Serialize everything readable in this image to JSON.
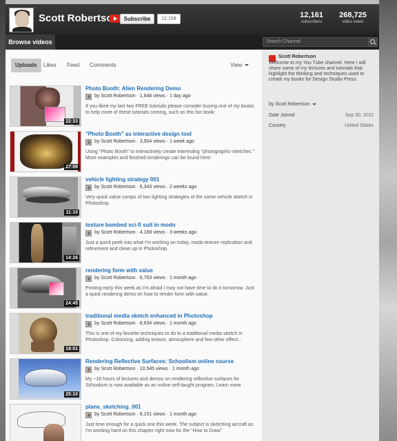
{
  "header": {
    "channel_name": "Scott Robertson",
    "subscribe_label": "Subscribe",
    "subscriber_bubble": "12,159",
    "stats": [
      {
        "number": "12,161",
        "label": "subscribers"
      },
      {
        "number": "268,725",
        "label": "video views"
      }
    ]
  },
  "nav": {
    "browse_label": "Browse videos",
    "search_placeholder": "Search Channel"
  },
  "tabs": {
    "uploads": "Uploads",
    "likes": "Likes",
    "feed": "Feed",
    "comments": "Comments",
    "view": "View"
  },
  "videos": [
    {
      "title": "Photo Booth: Alien Rendering Demo",
      "meta": "by Scott Robertson · 1,848 views · 1 day ago",
      "description": "If you liked my last two FREE tutorials please consider buying one of my books to help more of these tutorials coming, such as this fun book:",
      "duration": "22:33"
    },
    {
      "title": "\"Photo Booth\" as interactive design tool",
      "meta": "by Scott Robertson · 3,504 views · 1 week ago",
      "description": "Using \"Photo Booth\" to interactively create interesting \"photographic-sketches.\" More examples and finished renderings can be found here:",
      "duration": "27:08"
    },
    {
      "title": "vehicle lighting strategy 001",
      "meta": "by Scott Robertson · 6,343 views · 2 weeks ago",
      "description": "Very quick value comps of two lighting strategies of the same vehicle sketch in Photoshop.",
      "duration": "11:10"
    },
    {
      "title": "texture bombed sci-fi suit in modo",
      "meta": "by Scott Robertson · 4,168 views · 3 weeks ago",
      "description": "Just a quick peek into what I'm working on today, modo texture replication and refinement and clean up in Photoshop.",
      "duration": "14:26"
    },
    {
      "title": "rendering form with value",
      "meta": "by Scott Robertson · 6,703 views · 1 month ago",
      "description": "Posting early this week as I'm afraid I may not have time to do it tomorrow. Just a quick rendering demo on how to render form with value.",
      "duration": "24:45"
    },
    {
      "title": "traditional media sketch enhanced in Photoshop",
      "meta": "by Scott Robertson · 8,634 views · 1 month ago",
      "description": "This is one of my favorite techniques to do to a traditional media sketch in Photoshop. Colorizing, adding texture, atmosphere and few other effect...",
      "duration": "18:01"
    },
    {
      "title": "Rendering Reflective Surfaces: Schoolism online course",
      "meta": "by Scott Robertson · 10,545 views · 1 month ago",
      "description": "My ~18 hours of lectures and demos on rendering reflective surfaces for Schoolism is now available as an online self-taught program. Learn more",
      "duration": "25:10"
    },
    {
      "title": "plane_sketching_001",
      "meta": "by Scott Robertson · 6,151 views · 1 month ago",
      "description": "Just time enough for a quick one this week. The subject is sketching aircraft as I'm working hard on this chapter right now for the \"How to Draw\"",
      "duration": ""
    }
  ],
  "sidebar": {
    "name": "Scott Robertson",
    "about": "Welcome to my You Tube channel. Here I will share some of my lectures and tutorials that highlight the thinking and techniques used to create my books for Design Studio Press.",
    "by": "by Scott Robertson",
    "date_joined_label": "Date Joined",
    "date_joined_value": "Sep 30, 2011",
    "country_label": "Country",
    "country_value": "United States"
  }
}
